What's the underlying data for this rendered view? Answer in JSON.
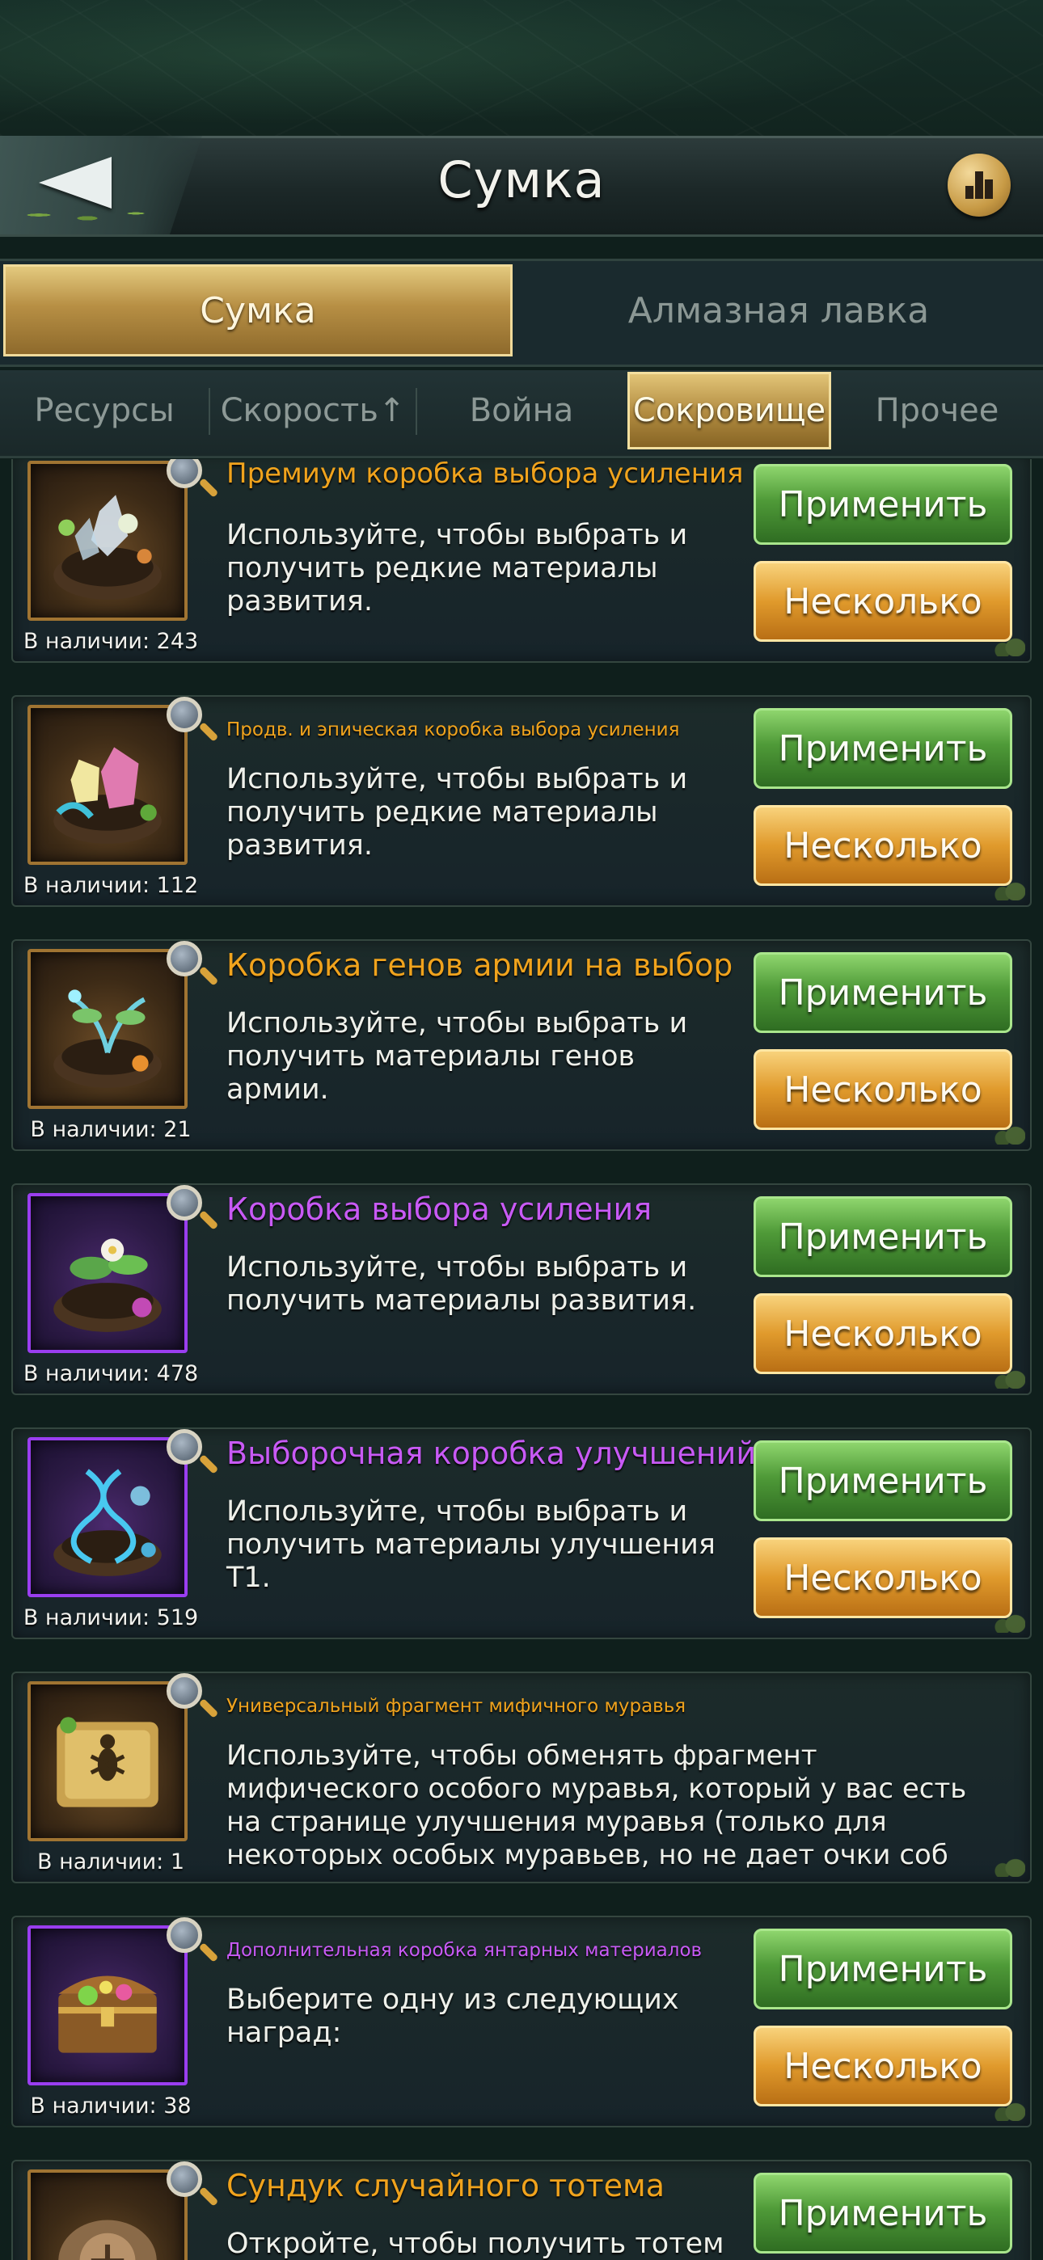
{
  "header": {
    "title": "Сумка"
  },
  "main_tabs": [
    {
      "label": "Сумка",
      "active": true
    },
    {
      "label": "Алмазная лавка",
      "active": false
    }
  ],
  "sub_tabs": [
    {
      "label": "Ресурсы",
      "active": false
    },
    {
      "label": "Скорость↑",
      "active": false
    },
    {
      "label": "Война",
      "active": false
    },
    {
      "label": "Сокровище",
      "active": true
    },
    {
      "label": "Прочее",
      "active": false
    }
  ],
  "colors": {
    "title_orange": "#f0a31d",
    "title_purple": "#c85af5",
    "apply_green": "#4f9a38",
    "multi_gold": "#e09a2c"
  },
  "items": [
    {
      "title": "Премиум коробка выбора усиления",
      "description": "Используйте, чтобы выбрать и получить редкие материалы развития.",
      "count": "В наличии: 243",
      "apply": "Применить",
      "multi": "Несколько",
      "rarity": "orange",
      "icon": "nest-crystals-icon"
    },
    {
      "title": "Продв. и эпическая коробка выбора усиления",
      "description": "Используйте, чтобы выбрать и получить редкие материалы развития.",
      "count": "В наличии: 112",
      "apply": "Применить",
      "multi": "Несколько",
      "rarity": "orange",
      "icon": "nest-pink-crystal-icon"
    },
    {
      "title": "Коробка генов армии на выбор",
      "description": "Используйте, чтобы выбрать и получить материалы генов армии.",
      "count": "В наличии: 21",
      "apply": "Применить",
      "multi": "Несколько",
      "rarity": "orange",
      "icon": "nest-glow-plant-icon"
    },
    {
      "title": "Коробка выбора усиления",
      "description": "Используйте, чтобы выбрать и получить материалы развития.",
      "count": "В наличии: 478",
      "apply": "Применить",
      "multi": "Несколько",
      "rarity": "purple",
      "icon": "nest-flower-icon"
    },
    {
      "title": "Выборочная коробка улучшений",
      "description": "Используйте, чтобы выбрать и получить материалы улучшения T1.",
      "count": "В наличии: 519",
      "apply": "Применить",
      "multi": "Несколько",
      "rarity": "purple",
      "icon": "nest-dna-icon"
    },
    {
      "title": "Универсальный фрагмент мифичного муравья",
      "description": "Используйте, чтобы обменять фрагмент мифического особого муравья, который у вас есть на странице улучшения муравья (только для некоторых особых муравьев, но не дает очки соб",
      "count": "В наличии: 1",
      "rarity": "orange",
      "icon": "ant-fragment-icon"
    },
    {
      "title": "Дополнительная коробка янтарных материалов",
      "description": "Выберите одну из следующих наград:",
      "count": "В наличии: 38",
      "apply": "Применить",
      "multi": "Несколько",
      "rarity": "purple",
      "icon": "treasure-chest-icon"
    },
    {
      "title": "Сундук случайного тотема",
      "description": "Откройте, чтобы получить тотем",
      "count": "",
      "apply": "Применить",
      "rarity": "orange",
      "icon": "totem-icon"
    }
  ]
}
